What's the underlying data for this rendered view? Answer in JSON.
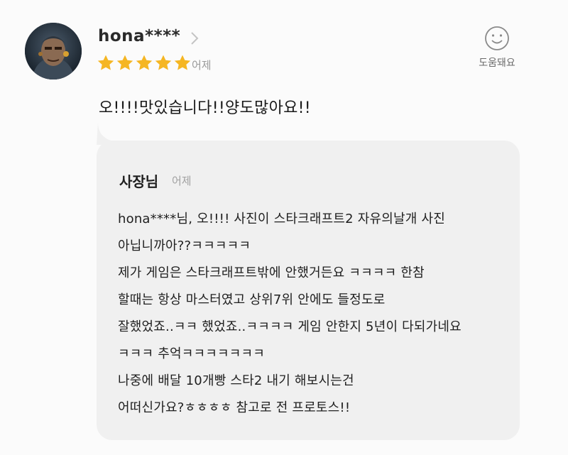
{
  "review": {
    "username": "hona****",
    "rating": 5,
    "date": "어제",
    "text": "오!!!!맛있습니다!!양도많아요!!"
  },
  "helpful": {
    "label": "도움돼요",
    "icon": "smiley-icon"
  },
  "reply": {
    "author": "사장님",
    "date": "어제",
    "lines": [
      "hona****님, 오!!!! 사진이 스타크래프트2 자유의날개 사진",
      "아닙니까아??ㅋㅋㅋㅋㅋ",
      "제가 게임은 스타크래프트밖에 안했거든요 ㅋㅋㅋㅋ 한참",
      "할때는 항상 마스터였고 상위7위 안에도 들정도로",
      "잘했었죠..ㅋㅋ 했었죠..ㅋㅋㅋㅋ 게임 안한지 5년이 다되가네요",
      "ㅋㅋㅋ 추억ㅋㅋㅋㅋㅋㅋㅋ",
      "나중에 배달 10개빵 스타2 내기 해보시는건",
      "어떠신가요?ㅎㅎㅎㅎ 참고로 전 프로토스!!"
    ]
  },
  "colors": {
    "star": "#f5b623",
    "reply_bg": "#f0f0f0",
    "muted_text": "#9a9a9a"
  }
}
